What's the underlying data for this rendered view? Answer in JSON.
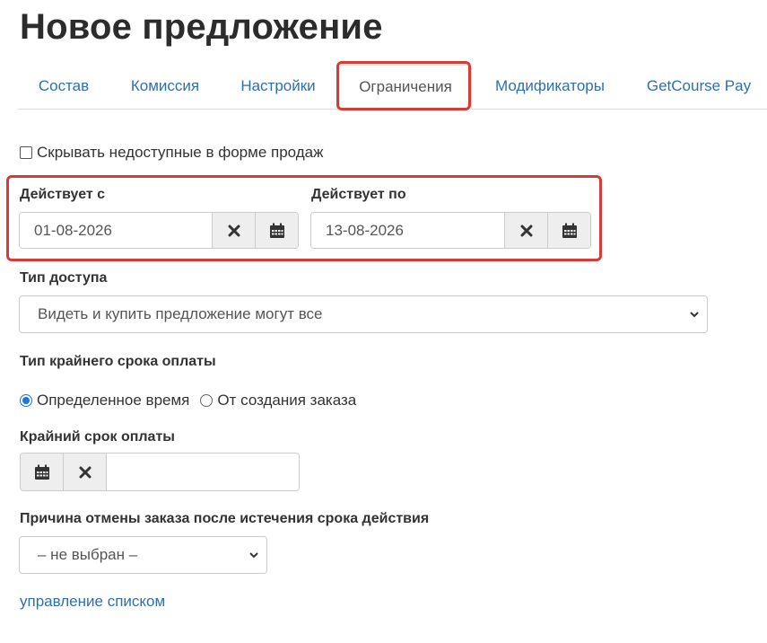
{
  "page": {
    "title": "Новое предложение"
  },
  "tabs": [
    {
      "label": "Состав"
    },
    {
      "label": "Комиссия"
    },
    {
      "label": "Настройки"
    },
    {
      "label": "Ограничения",
      "active": true
    },
    {
      "label": "Модификаторы"
    },
    {
      "label": "GetCourse Pay"
    }
  ],
  "hide_unavailable": {
    "label": "Скрывать недоступные в форме продаж",
    "checked": false
  },
  "valid_from": {
    "label": "Действует с",
    "value": "01-08-2026"
  },
  "valid_to": {
    "label": "Действует по",
    "value": "13-08-2026"
  },
  "access_type": {
    "label": "Тип доступа",
    "selected": "Видеть и купить предложение могут все"
  },
  "deadline_type": {
    "label": "Тип крайнего срока оплаты",
    "options": [
      {
        "label": "Определенное время",
        "checked": true
      },
      {
        "label": "От создания заказа",
        "checked": false
      }
    ]
  },
  "deadline": {
    "label": "Крайний срок оплаты",
    "value": ""
  },
  "cancel_reason": {
    "label": "Причина отмены заказа после истечения срока действия",
    "selected": "– не выбран –"
  },
  "manage_link": {
    "label": "управление списком"
  },
  "colors": {
    "link": "#2f6fb0",
    "highlight": "#d93a35",
    "radio": "#1a73e8"
  }
}
